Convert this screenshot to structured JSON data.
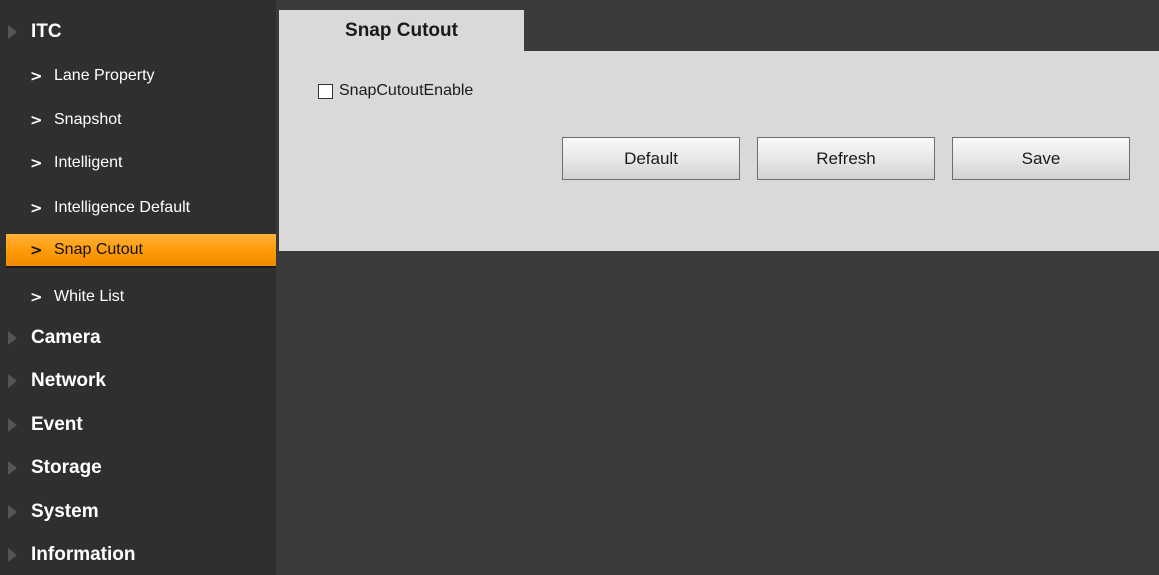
{
  "sidebar": {
    "items": [
      {
        "label": "ITC",
        "level": "top"
      },
      {
        "label": "Lane Property",
        "level": "sub"
      },
      {
        "label": "Snapshot",
        "level": "sub"
      },
      {
        "label": "Intelligent",
        "level": "sub"
      },
      {
        "label": "Intelligence Default",
        "level": "sub"
      },
      {
        "label": "Snap Cutout",
        "level": "sub",
        "active": true
      },
      {
        "label": "White List",
        "level": "sub"
      },
      {
        "label": "Camera",
        "level": "top"
      },
      {
        "label": "Network",
        "level": "top"
      },
      {
        "label": "Event",
        "level": "top"
      },
      {
        "label": "Storage",
        "level": "top"
      },
      {
        "label": "System",
        "level": "top"
      },
      {
        "label": "Information",
        "level": "top"
      }
    ]
  },
  "tab": {
    "label": "Snap Cutout"
  },
  "panel": {
    "checkbox": {
      "label": "SnapCutoutEnable",
      "checked": false
    },
    "buttons": {
      "default": "Default",
      "refresh": "Refresh",
      "save": "Save"
    }
  },
  "colors": {
    "accent": "#ff9a05",
    "panel": "#d9d9d9",
    "background": "#3a3a3a"
  }
}
